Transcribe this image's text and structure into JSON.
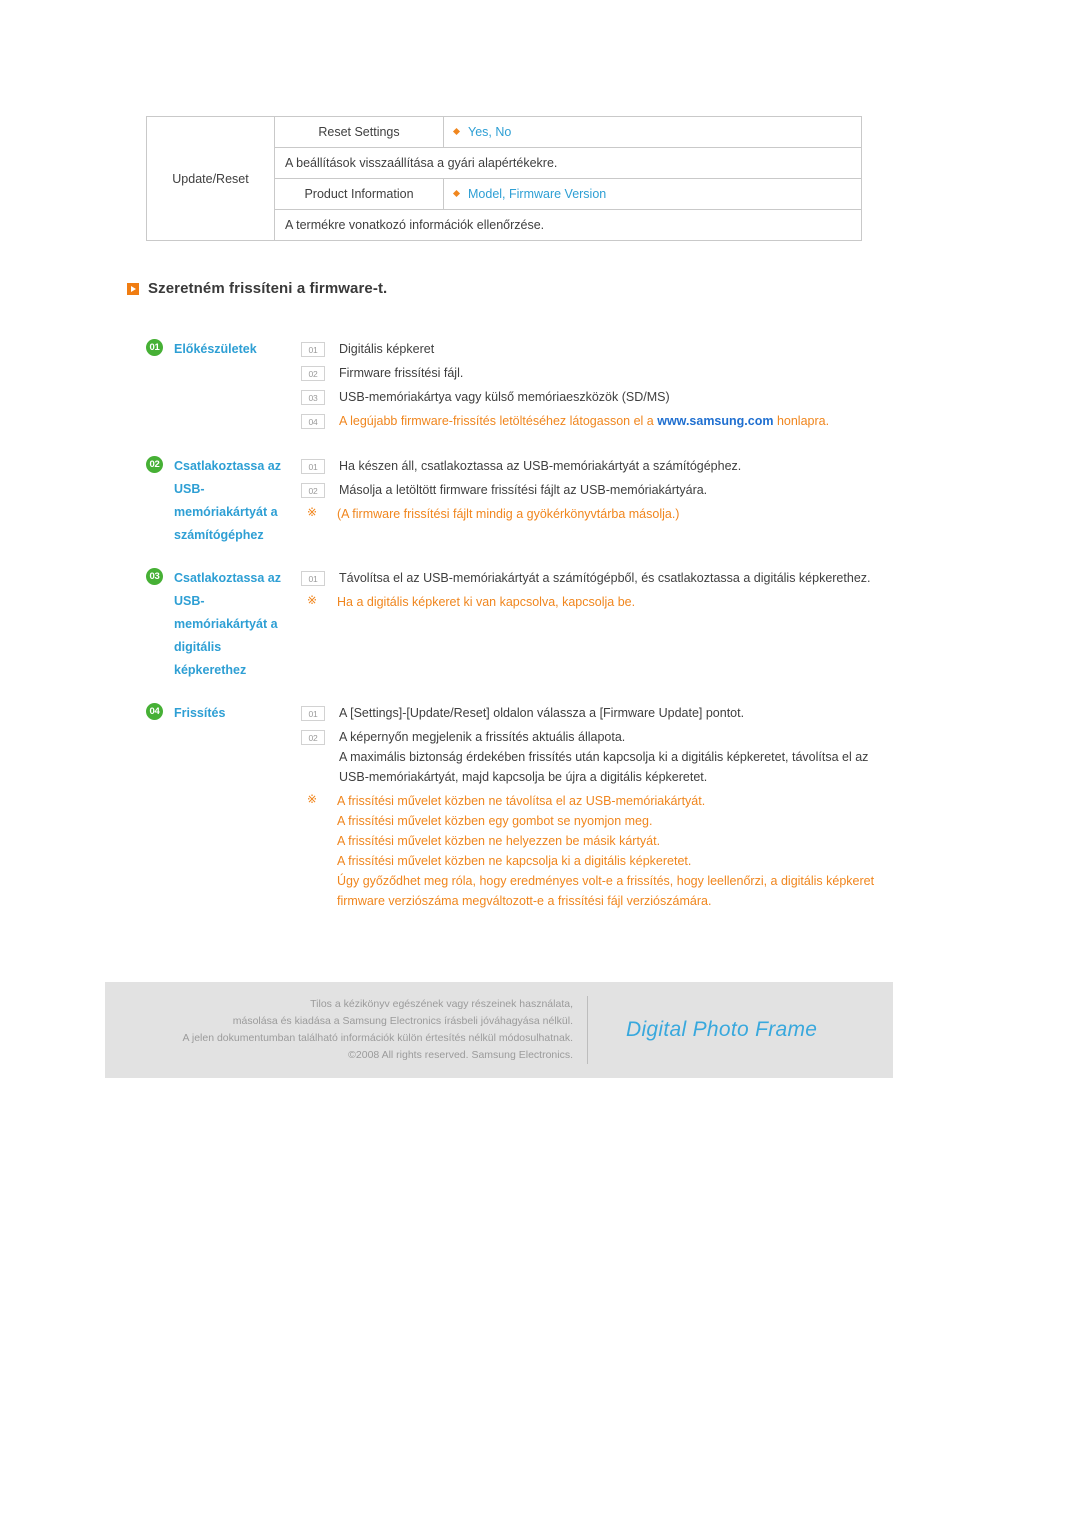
{
  "settings_table": {
    "category": "Update/Reset",
    "rows": [
      {
        "item": "Reset Settings",
        "value": "Yes, No",
        "description": "A beállítások visszaállítása a gyári alapértékekre."
      },
      {
        "item": "Product Information",
        "value": "Model, Firmware Version",
        "description": "A termékre vonatkozó információk ellenőrzése."
      }
    ]
  },
  "section": {
    "heading": "Szeretném frissíteni a firmware-t.",
    "marker_icon": "orange-arrow-marker"
  },
  "steps": [
    {
      "badge": "01",
      "label": "Előkészületek",
      "rows": [
        {
          "kind": "num",
          "num": "01",
          "text": "Digitális képkeret"
        },
        {
          "kind": "num",
          "num": "02",
          "text": "Firmware frissítési fájl."
        },
        {
          "kind": "num",
          "num": "03",
          "text": "USB-memóriakártya vagy külső memóriaeszközök (SD/MS)"
        },
        {
          "kind": "num",
          "num": "04",
          "text_pre": "A legújabb firmware-frissítés letöltéséhez látogasson el a ",
          "link": "www.samsung.com",
          "text_post": " honlapra."
        }
      ]
    },
    {
      "badge": "02",
      "label": "Csatlakoztassa az USB-memóriakártyát a számítógéphez",
      "rows": [
        {
          "kind": "num",
          "num": "01",
          "text": "Ha készen áll, csatlakoztassa az USB-memóriakártyát a számítógéphez."
        },
        {
          "kind": "num",
          "num": "02",
          "text": "Másolja a letöltött firmware frissítési fájlt az USB-memóriakártyára."
        },
        {
          "kind": "note",
          "mark": "※",
          "text": "(A firmware frissítési fájlt mindig a gyökérkönyvtárba másolja.)"
        }
      ]
    },
    {
      "badge": "03",
      "label": "Csatlakoztassa az USB-memóriakártyát a digitális képkerethez",
      "rows": [
        {
          "kind": "num",
          "num": "01",
          "text": "Távolítsa el az USB-memóriakártyát a számítógépből, és csatlakoztassa a digitális képkerethez."
        },
        {
          "kind": "note",
          "mark": "※",
          "text": "Ha a digitális képkeret ki van kapcsolva, kapcsolja be."
        }
      ]
    },
    {
      "badge": "04",
      "label": "Frissítés",
      "rows": [
        {
          "kind": "num",
          "num": "01",
          "text": "A [Settings]-[Update/Reset] oldalon válassza a [Firmware Update] pontot."
        },
        {
          "kind": "num",
          "num": "02",
          "text": "A képernyőn megjelenik a frissítés aktuális állapota.\nA maximális biztonság érdekében frissítés után kapcsolja ki a digitális képkeretet, távolítsa el az USB-memóriakártyát, majd kapcsolja be újra a digitális képkeretet."
        },
        {
          "kind": "note",
          "mark": "※",
          "text": "A frissítési művelet közben ne távolítsa el az USB-memóriakártyát.\nA frissítési művelet közben egy gombot se nyomjon meg.\nA frissítési művelet közben ne helyezzen be másik kártyát.\nA frissítési művelet közben ne kapcsolja ki a digitális képkeretet.\nÚgy győződhet meg róla, hogy eredményes volt-e a frissítés, hogy leellenőrzi, a digitális képkeret firmware verziószáma megváltozott-e a frissítési fájl verziószámára."
        }
      ]
    }
  ],
  "footer": {
    "copyright_lines": [
      "Tilos a kézikönyv egészének vagy részeinek használata,",
      "másolása és kiadása a Samsung Electronics írásbeli jóváhagyása nélkül.",
      "A jelen dokumentumban található információk külön értesítés nélkül módosulhatnak.",
      "©2008 All rights reserved. Samsung Electronics."
    ],
    "brand": "Digital Photo Frame"
  },
  "colors": {
    "accent_orange": "#f0861e",
    "accent_blue": "#2e9fd4",
    "badge_green": "#46b035",
    "link_blue": "#1f6fd0"
  }
}
